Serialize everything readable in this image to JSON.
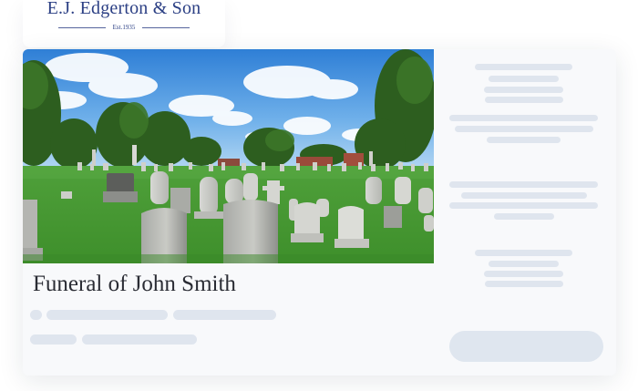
{
  "brand": {
    "name": "E.J. Edgerton & Son",
    "established": "Est.1935"
  },
  "listing": {
    "title": "Funeral of John Smith",
    "image_alt": "Cemetery with rows of headstones on a sunny day"
  },
  "icons": {
    "status_dot": "status-dot-icon"
  },
  "colors": {
    "brand_blue": "#2b3f84",
    "skeleton": "#dfe5ee",
    "card_background": "#f8f9fb",
    "title_text": "#2a2c34"
  }
}
